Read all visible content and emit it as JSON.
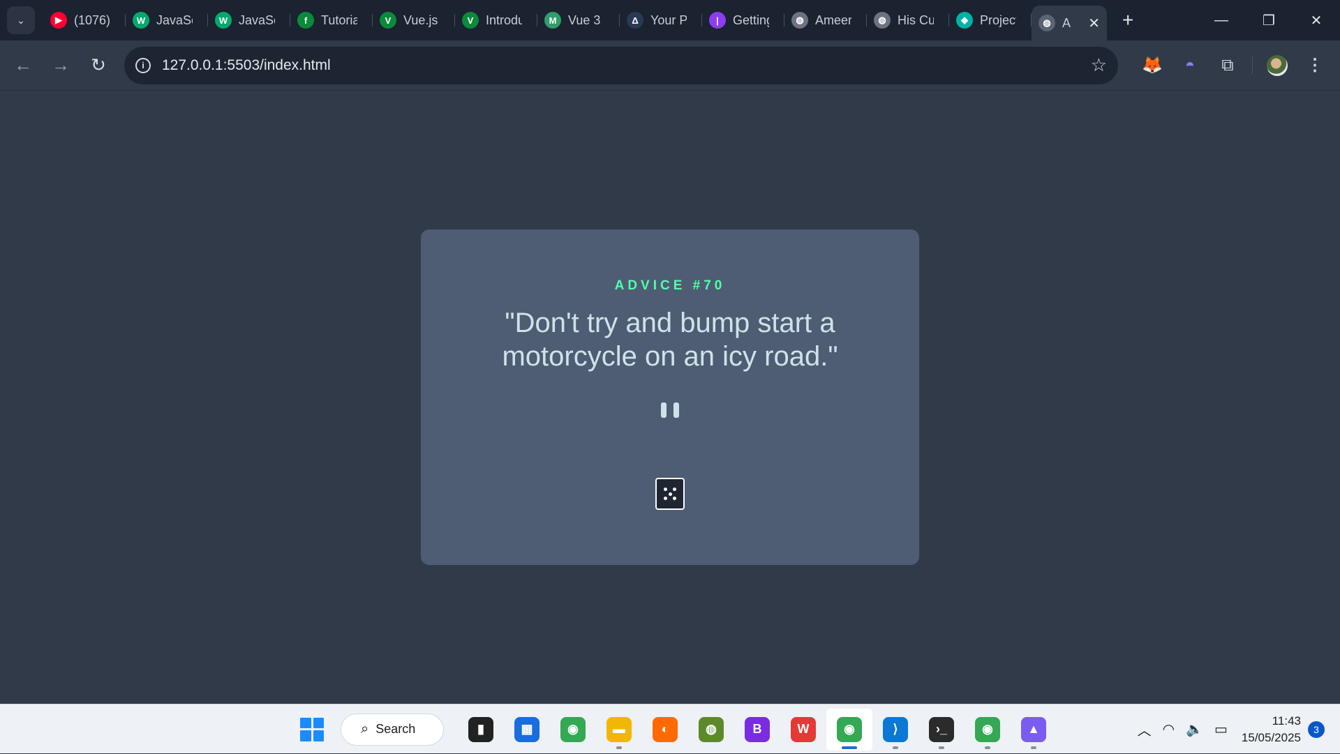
{
  "browser": {
    "tabs": [
      {
        "title": "(1076)",
        "icon": "youtube-icon",
        "color": "#ff0033",
        "glyph": "▶"
      },
      {
        "title": "JavaScript",
        "icon": "w3schools-icon",
        "color": "#04aa6d",
        "glyph": "W"
      },
      {
        "title": "JavaScript",
        "icon": "w3schools-icon",
        "color": "#04aa6d",
        "glyph": "W"
      },
      {
        "title": "Tutorial",
        "icon": "freecodecamp-icon",
        "color": "#0a8a3a",
        "glyph": "f"
      },
      {
        "title": "Vue.js",
        "icon": "vue-icon",
        "color": "#0a8a3a",
        "glyph": "V"
      },
      {
        "title": "Introduction",
        "icon": "vue-icon",
        "color": "#0a8a3a",
        "glyph": "V"
      },
      {
        "title": "Vue 3",
        "icon": "vuemastery-icon",
        "color": "#2f9e6b",
        "glyph": "M"
      },
      {
        "title": "Your Projects",
        "icon": "netlify-icon",
        "color": "#2a3a55",
        "glyph": "Δ"
      },
      {
        "title": "Getting",
        "icon": "platform-icon",
        "color": "#8d3df0",
        "glyph": "|"
      },
      {
        "title": "Ameer",
        "icon": "globe-icon",
        "color": "#6b7280",
        "glyph": "◍"
      },
      {
        "title": "His Culture",
        "icon": "globe-icon",
        "color": "#6b7280",
        "glyph": "◍"
      },
      {
        "title": "Projects",
        "icon": "frontendmentor-icon",
        "color": "#00b3a4",
        "glyph": "◆"
      }
    ],
    "active_tab": {
      "title": "A",
      "icon": "globe-icon"
    },
    "address": "127.0.0.1:5503/index.html"
  },
  "advice": {
    "id_label": "ADVICE #70",
    "quote": "\"Don't try and bump start a motorcycle on an icy road.\""
  },
  "taskbar": {
    "search_label": "Search",
    "time": "11:43",
    "date": "15/05/2025",
    "notification_count": "3",
    "apps": [
      {
        "name": "file-explorer-tasks",
        "color": "#222",
        "glyph": "▮",
        "running": false
      },
      {
        "name": "microsoft-store",
        "color": "#1a6dde",
        "glyph": "▦",
        "running": false
      },
      {
        "name": "chrome",
        "color": "#34a853",
        "glyph": "◉",
        "running": false
      },
      {
        "name": "file-explorer",
        "color": "#f2b705",
        "glyph": "▬",
        "running": true
      },
      {
        "name": "firefox",
        "color": "#ff6a00",
        "glyph": "◐",
        "running": false
      },
      {
        "name": "chameleon",
        "color": "#5c8a2a",
        "glyph": "◍",
        "running": false
      },
      {
        "name": "bootstrap-studio",
        "color": "#7b2be2",
        "glyph": "B",
        "running": false
      },
      {
        "name": "wps-office",
        "color": "#e53935",
        "glyph": "W",
        "running": false
      },
      {
        "name": "chrome-profile",
        "color": "#34a853",
        "glyph": "◉",
        "running": true,
        "active": true
      },
      {
        "name": "vscode",
        "color": "#0a78d4",
        "glyph": "⟩",
        "running": true
      },
      {
        "name": "terminal",
        "color": "#2b2b2b",
        "glyph": "›_",
        "running": true
      },
      {
        "name": "chrome-profile-2",
        "color": "#34a853",
        "glyph": "◉",
        "running": true
      },
      {
        "name": "dev-app",
        "color": "#7b5cf0",
        "glyph": "▲",
        "running": true
      }
    ]
  }
}
